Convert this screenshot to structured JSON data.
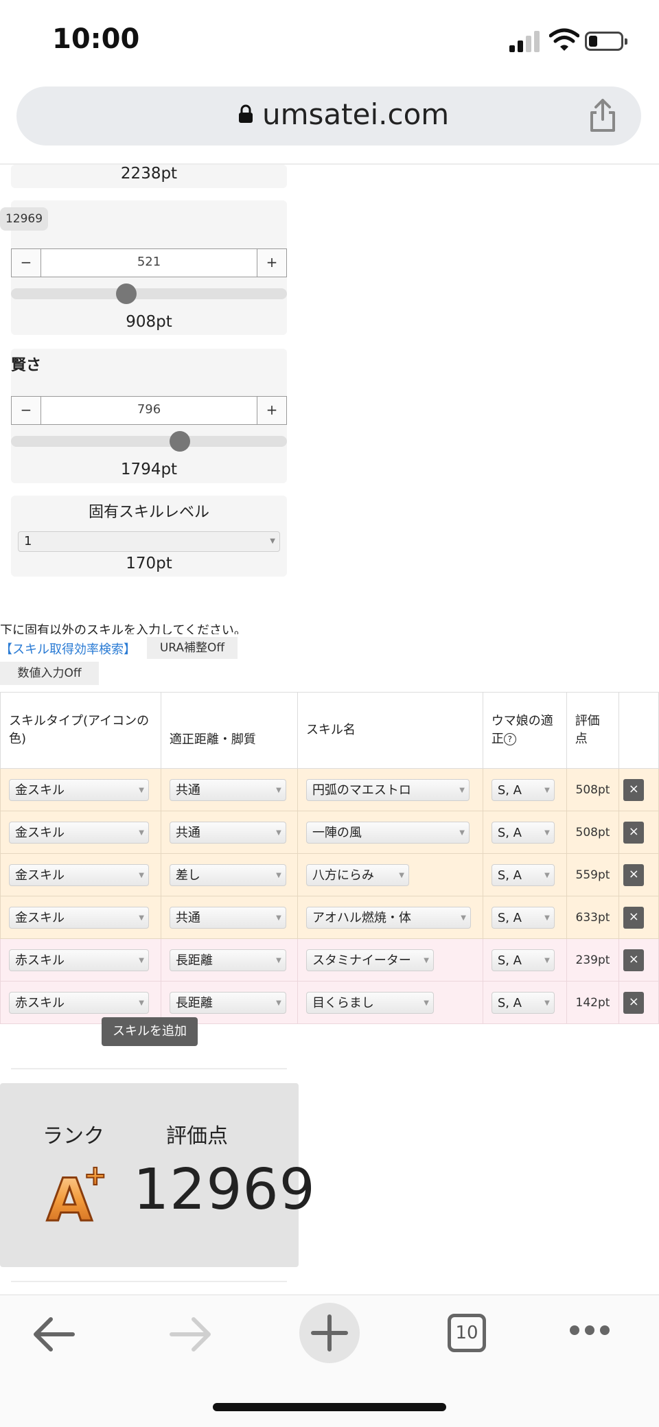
{
  "status_bar": {
    "time": "10:00"
  },
  "browser": {
    "url": "umsatei.com",
    "tab_count": "10"
  },
  "stats": {
    "power_pt": "2238pt",
    "score_chip": "12969",
    "guts": {
      "value": "521",
      "pt": "908pt",
      "level": 0.41,
      "minus": "−",
      "plus": "+"
    },
    "wisdom": {
      "label": "賢さ",
      "value": "796",
      "pt": "1794pt",
      "level": 0.62,
      "minus": "−",
      "plus": "+"
    },
    "unique_skill": {
      "label": "固有スキルレベル",
      "selected": "1",
      "pt": "170pt"
    }
  },
  "instructions": "下に固有以外のスキルを入力してください。",
  "links": {
    "efficiency_search": "【スキル取得効率検索】"
  },
  "toggles": {
    "ura": "URA補整Off",
    "numeric": "数値入力Off"
  },
  "table": {
    "headers": [
      "スキルタイプ(アイコンの色)",
      "適正距離・脚質",
      "スキル名",
      "ウマ娘の適正",
      "評価点"
    ],
    "rows": [
      {
        "type": "金スキル",
        "distance": "共通",
        "name": "円弧のマエストロ",
        "aptitude": "S, A",
        "points": "508pt",
        "color": "gold"
      },
      {
        "type": "金スキル",
        "distance": "共通",
        "name": "一陣の風",
        "aptitude": "S, A",
        "points": "508pt",
        "color": "gold"
      },
      {
        "type": "金スキル",
        "distance": "差し",
        "name": "八方にらみ",
        "aptitude": "S, A",
        "points": "559pt",
        "color": "gold"
      },
      {
        "type": "金スキル",
        "distance": "共通",
        "name": "アオハル燃焼・体",
        "aptitude": "S, A",
        "points": "633pt",
        "color": "gold"
      },
      {
        "type": "赤スキル",
        "distance": "長距離",
        "name": "スタミナイーター",
        "aptitude": "S, A",
        "points": "239pt",
        "color": "red"
      },
      {
        "type": "赤スキル",
        "distance": "長距離",
        "name": "目くらまし",
        "aptitude": "S, A",
        "points": "142pt",
        "color": "red"
      }
    ],
    "delete_label": "×"
  },
  "add_skill_button": "スキルを追加",
  "result": {
    "rank_label": "ランク",
    "score_label": "評価点",
    "rank": "A",
    "rank_modifier": "+",
    "score": "12969"
  },
  "colors": {
    "gold_row": "#fff1dc",
    "red_row": "#fdeef2",
    "button_dark": "#5f5f5f",
    "link": "#2a7bd4",
    "rank_orange": "#e07a1e"
  }
}
